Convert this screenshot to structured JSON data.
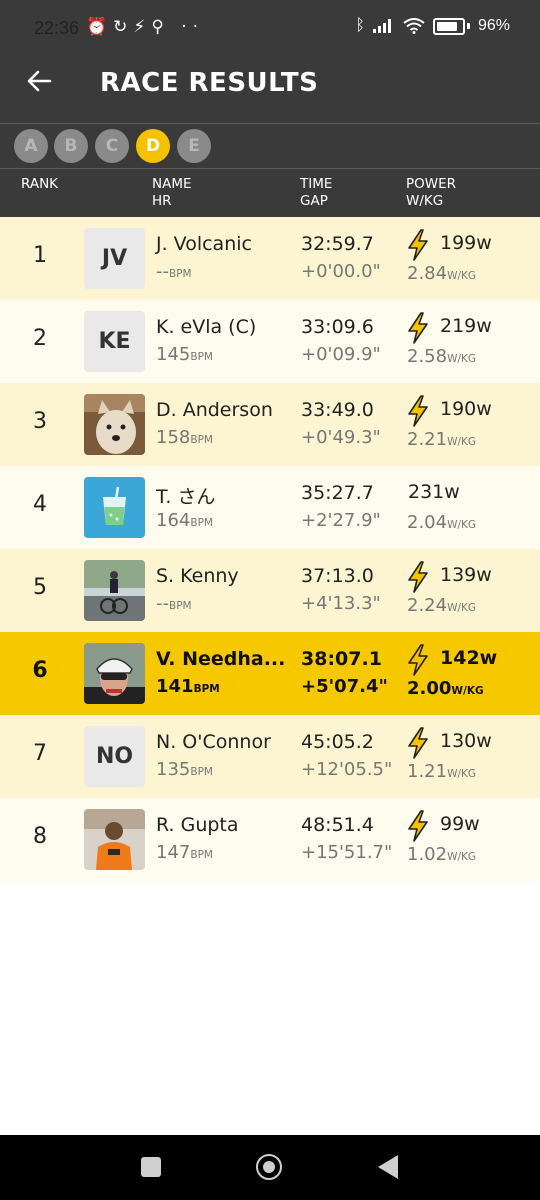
{
  "status": {
    "time": "22:36",
    "battery": "96%"
  },
  "header": {
    "title": "RACE RESULTS"
  },
  "categories": [
    {
      "label": "A",
      "active": false
    },
    {
      "label": "B",
      "active": false
    },
    {
      "label": "C",
      "active": false
    },
    {
      "label": "D",
      "active": true
    },
    {
      "label": "E",
      "active": false
    }
  ],
  "columns": {
    "rank": "RANK",
    "name": "NAME",
    "hr": "HR",
    "time": "TIME",
    "gap": "GAP",
    "power": "POWER",
    "wkg": "W/KG"
  },
  "units": {
    "bpm": "BPM",
    "wkg": "W/KG"
  },
  "results": [
    {
      "rank": "1",
      "avatar": "JV",
      "name": "J. Volcanic",
      "hr": "--",
      "time": "32:59.7",
      "gap": "+0'00.0\"",
      "watts": "199w",
      "wkg": "2.84",
      "power_icon": true
    },
    {
      "rank": "2",
      "avatar": "KE",
      "name": "K. eVla (C)",
      "hr": "145",
      "time": "33:09.6",
      "gap": "+0'09.9\"",
      "watts": "219w",
      "wkg": "2.58",
      "power_icon": true
    },
    {
      "rank": "3",
      "avatar": "",
      "name": "D. Anderson",
      "hr": "158",
      "time": "33:49.0",
      "gap": "+0'49.3\"",
      "watts": "190w",
      "wkg": "2.21",
      "power_icon": true
    },
    {
      "rank": "4",
      "avatar": "",
      "name": "T. さん",
      "hr": "164",
      "time": "35:27.7",
      "gap": "+2'27.9\"",
      "watts": "231w",
      "wkg": "2.04",
      "power_icon": false
    },
    {
      "rank": "5",
      "avatar": "",
      "name": "S. Kenny",
      "hr": "--",
      "time": "37:13.0",
      "gap": "+4'13.3\"",
      "watts": "139w",
      "wkg": "2.24",
      "power_icon": true
    },
    {
      "rank": "6",
      "avatar": "",
      "name": "V. Needha...",
      "hr": "141",
      "time": "38:07.1",
      "gap": "+5'07.4\"",
      "watts": "142w",
      "wkg": "2.00",
      "power_icon": true
    },
    {
      "rank": "7",
      "avatar": "NO",
      "name": "N. O'Connor",
      "hr": "135",
      "time": "45:05.2",
      "gap": "+12'05.5\"",
      "watts": "130w",
      "wkg": "1.21",
      "power_icon": true
    },
    {
      "rank": "8",
      "avatar": "",
      "name": "R. Gupta",
      "hr": "147",
      "time": "48:51.4",
      "gap": "+15'51.7\"",
      "watts": "99w",
      "wkg": "1.02",
      "power_icon": true
    }
  ]
}
